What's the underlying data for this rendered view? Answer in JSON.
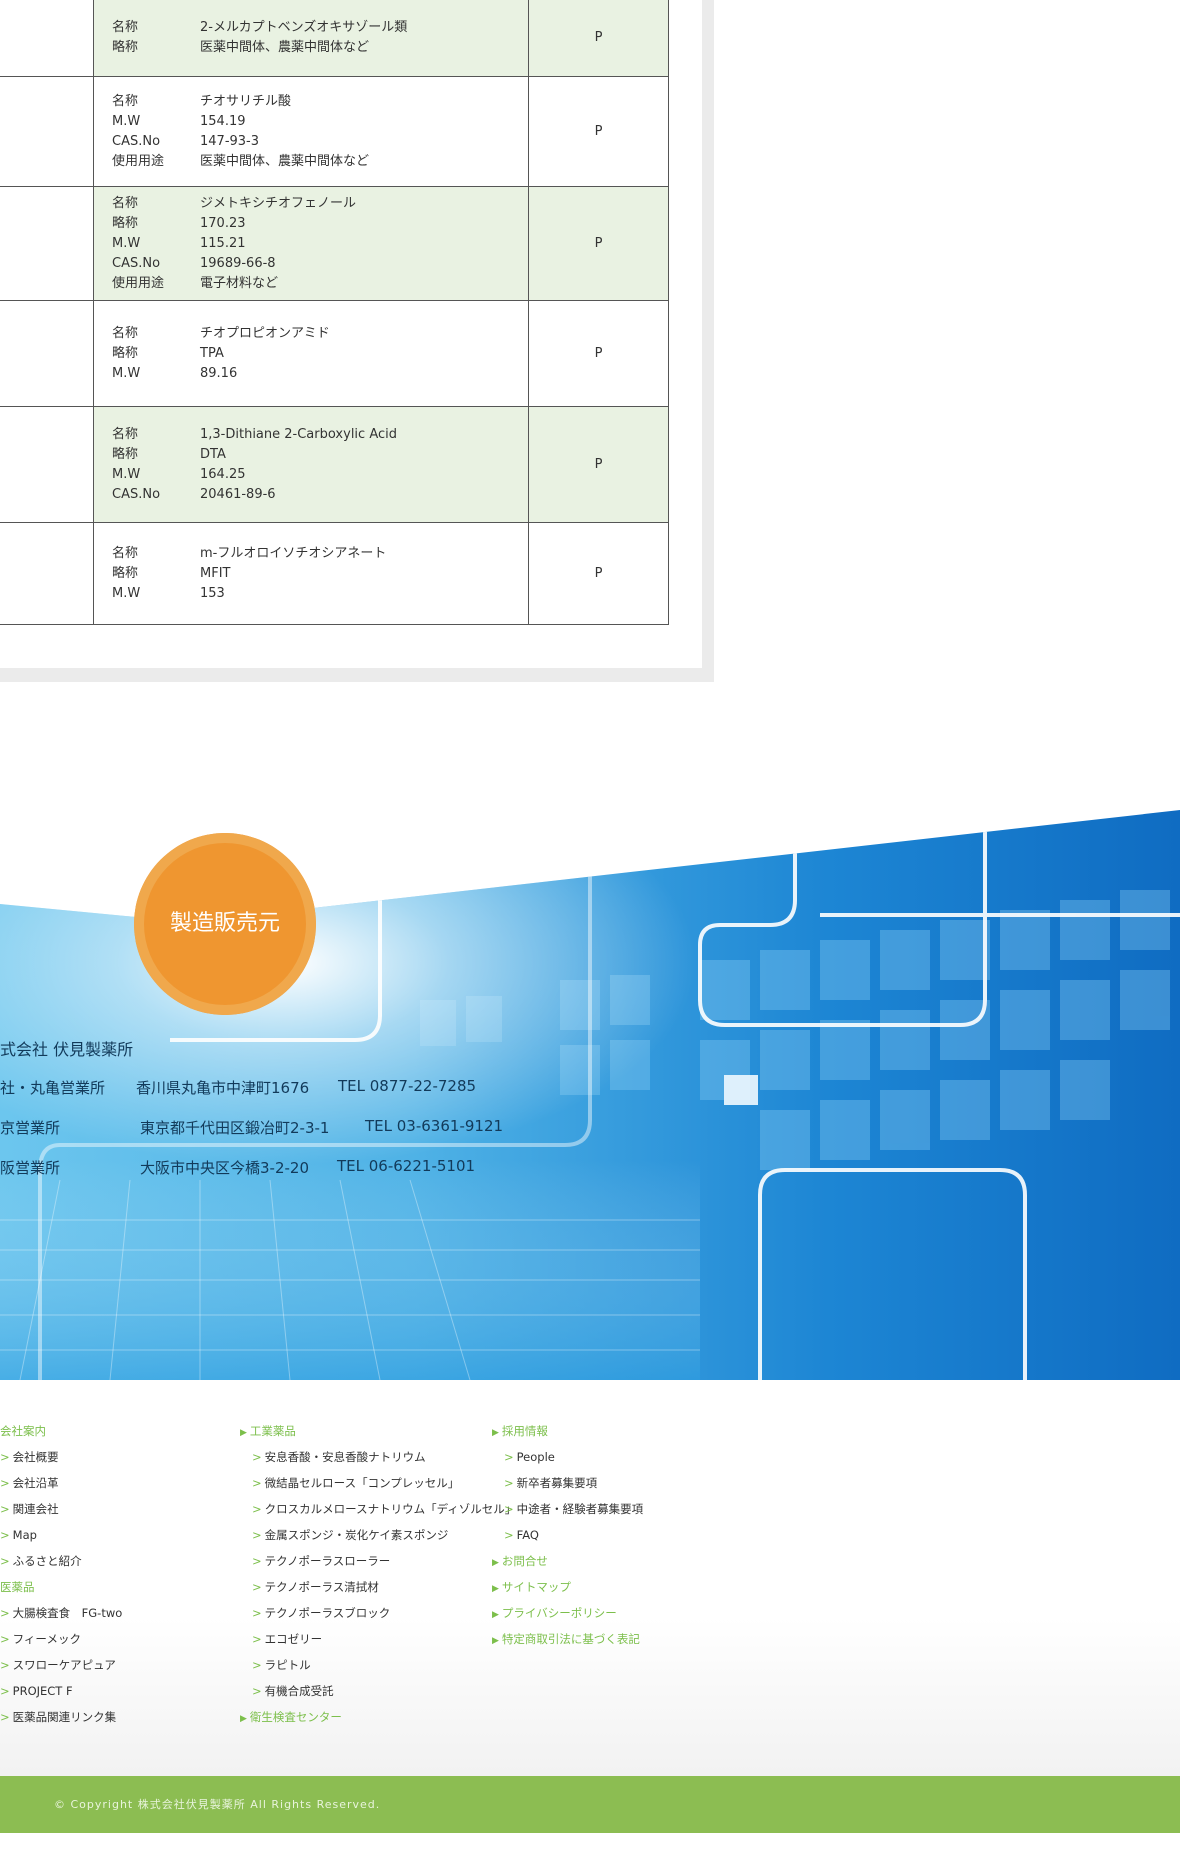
{
  "products": [
    {
      "shaded": true,
      "labels": [
        "名称",
        "略称"
      ],
      "values": [
        "2-メルカプトベンズオキサゾール類",
        "医薬中間体、農薬中間体など"
      ],
      "grade": "P"
    },
    {
      "shaded": false,
      "labels": [
        "名称",
        "M.W",
        "CAS.No",
        "使用用途"
      ],
      "values": [
        "チオサリチル酸",
        "154.19",
        "147-93-3",
        "医薬中間体、農薬中間体など"
      ],
      "grade": "P"
    },
    {
      "shaded": true,
      "labels": [
        "名称",
        "略称",
        "M.W",
        "CAS.No",
        "使用用途"
      ],
      "values": [
        "ジメトキシチオフェノール",
        "170.23",
        "115.21",
        "19689-66-8",
        "電子材料など"
      ],
      "grade": "P"
    },
    {
      "shaded": false,
      "labels": [
        "名称",
        "略称",
        "M.W"
      ],
      "values": [
        "チオプロピオンアミド",
        "TPA",
        "89.16"
      ],
      "grade": "P"
    },
    {
      "shaded": true,
      "labels": [
        "名称",
        "略称",
        "M.W",
        "CAS.No"
      ],
      "values": [
        "1,3-Dithiane 2-Carboxylic Acid",
        "DTA",
        "164.25",
        "20461-89-6"
      ],
      "grade": "P"
    },
    {
      "shaded": false,
      "labels": [
        "名称",
        "略称",
        "M.W"
      ],
      "values": [
        "m-フルオロイソチオシアネート",
        "MFIT",
        "153"
      ],
      "grade": "P"
    }
  ],
  "banner": {
    "badge": "製造販売元",
    "company": "式会社 伏見製薬所",
    "offices": [
      {
        "name": "社・丸亀営業所",
        "address": "香川県丸亀市中津町1676",
        "tel": "TEL 0877-22-7285"
      },
      {
        "name": "京営業所",
        "address": "東京都千代田区鍛冶町2-3-1",
        "tel": "TEL 03-6361-9121"
      },
      {
        "name": "阪営業所",
        "address": "大阪市中央区今橋3-2-20",
        "tel": "TEL 06-6221-5101"
      }
    ]
  },
  "footer": {
    "col1": [
      {
        "type": "sec",
        "text": "会社案内"
      },
      {
        "type": "sub",
        "text": "会社概要"
      },
      {
        "type": "sub",
        "text": "会社沿革"
      },
      {
        "type": "sub",
        "text": "関連会社"
      },
      {
        "type": "sub",
        "text": "Map"
      },
      {
        "type": "sub",
        "text": "ふるさと紹介"
      },
      {
        "type": "sec",
        "text": "医薬品"
      },
      {
        "type": "sub",
        "text": "大腸検査食　FG-two"
      },
      {
        "type": "sub",
        "text": "フィーメック"
      },
      {
        "type": "sub",
        "text": "スワローケアピュア"
      },
      {
        "type": "sub",
        "text": "PROJECT F"
      },
      {
        "type": "sub",
        "text": "医薬品関連リンク集"
      }
    ],
    "col2": [
      {
        "type": "head",
        "text": "工業薬品"
      },
      {
        "type": "sub",
        "text": "安息香酸・安息香酸ナトリウム"
      },
      {
        "type": "sub",
        "text": "微結晶セルロース「コンプレッセル」"
      },
      {
        "type": "sub",
        "text": "クロスカルメロースナトリウム「ディゾルセル」"
      },
      {
        "type": "sub",
        "text": "金属スポンジ・炭化ケイ素スポンジ"
      },
      {
        "type": "sub",
        "text": "テクノポーラスローラー"
      },
      {
        "type": "sub",
        "text": "テクノポーラス清拭材"
      },
      {
        "type": "sub",
        "text": "テクノポーラスブロック"
      },
      {
        "type": "sub",
        "text": "エコゼリー"
      },
      {
        "type": "sub",
        "text": "ラピトル"
      },
      {
        "type": "sub",
        "text": "有機合成受託"
      },
      {
        "type": "head",
        "text": "衛生検査センター"
      }
    ],
    "col3": [
      {
        "type": "head",
        "text": "採用情報"
      },
      {
        "type": "sub",
        "text": "People"
      },
      {
        "type": "sub",
        "text": "新卒者募集要項"
      },
      {
        "type": "sub",
        "text": "中途者・経験者募集要項"
      },
      {
        "type": "sub",
        "text": "FAQ"
      },
      {
        "type": "head",
        "text": "お問合せ"
      },
      {
        "type": "head",
        "text": "サイトマップ"
      },
      {
        "type": "head",
        "text": "プライバシーポリシー"
      },
      {
        "type": "head",
        "text": "特定商取引法に基づく表記"
      }
    ],
    "copyright": "© Copyright 株式会社伏見製薬所 All Rights Reserved."
  }
}
